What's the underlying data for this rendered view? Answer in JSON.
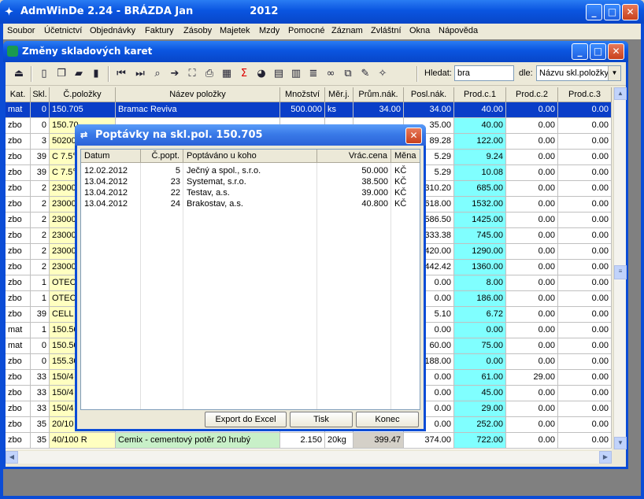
{
  "app": {
    "title": "AdmWinDe 2.24 - BRÁZDA Jan",
    "year": "2012",
    "logo": "app-logo-icon"
  },
  "menu": [
    "Soubor",
    "Účetnictví",
    "Objednávky",
    "Faktury",
    "Zásoby",
    "Majetek",
    "Mzdy",
    "Pomocné",
    "Záznam",
    "Zvláštní",
    "Okna",
    "Nápověda"
  ],
  "child": {
    "title": "Změny skladových karet",
    "search_label": "Hledat:",
    "search_value": "bra",
    "by_label": "dle:",
    "by_value": "Názvu skl.položky"
  },
  "grid": {
    "headers": [
      "Kat.",
      "Skl.",
      "Č.položky",
      "Název položky",
      "Množství",
      "Měr.j.",
      "Prům.nák.",
      "Posl.nák.",
      "Prod.c.1",
      "Prod.c.2",
      "Prod.c.3"
    ],
    "rows": [
      [
        "mat",
        "0",
        "150.705",
        "Bramac Reviva",
        "500.000",
        "ks",
        "34.00",
        "34.00",
        "40.00",
        "0.00",
        "0.00"
      ],
      [
        "zbo",
        "0",
        "150.70",
        "",
        "",
        "",
        "",
        "35.00",
        "40.00",
        "0.00",
        "0.00"
      ],
      [
        "zbo",
        "3",
        "50200",
        "",
        "",
        "",
        "",
        "89.28",
        "122.00",
        "0.00",
        "0.00"
      ],
      [
        "zbo",
        "39",
        "C 7.5°",
        "",
        "",
        "",
        "",
        "5.29",
        "9.24",
        "0.00",
        "0.00"
      ],
      [
        "zbo",
        "39",
        "C 7.5°",
        "",
        "",
        "",
        "",
        "5.29",
        "10.08",
        "0.00",
        "0.00"
      ],
      [
        "zbo",
        "2",
        "23000",
        "",
        "",
        "",
        "",
        "310.20",
        "685.00",
        "0.00",
        "0.00"
      ],
      [
        "zbo",
        "2",
        "23000",
        "",
        "",
        "",
        "",
        "618.00",
        "1532.00",
        "0.00",
        "0.00"
      ],
      [
        "zbo",
        "2",
        "23000",
        "",
        "",
        "",
        "",
        "586.50",
        "1425.00",
        "0.00",
        "0.00"
      ],
      [
        "zbo",
        "2",
        "23000",
        "",
        "",
        "",
        "",
        "333.38",
        "745.00",
        "0.00",
        "0.00"
      ],
      [
        "zbo",
        "2",
        "23000",
        "",
        "",
        "",
        "",
        "420.00",
        "1290.00",
        "0.00",
        "0.00"
      ],
      [
        "zbo",
        "2",
        "23000",
        "",
        "",
        "",
        "",
        "442.42",
        "1360.00",
        "0.00",
        "0.00"
      ],
      [
        "zbo",
        "1",
        "OTEC",
        "",
        "",
        "",
        "",
        "0.00",
        "8.00",
        "0.00",
        "0.00"
      ],
      [
        "zbo",
        "1",
        "OTEC",
        "",
        "",
        "",
        "",
        "0.00",
        "186.00",
        "0.00",
        "0.00"
      ],
      [
        "zbo",
        "39",
        "CELL",
        "",
        "",
        "",
        "",
        "5.10",
        "6.72",
        "0.00",
        "0.00"
      ],
      [
        "mat",
        "1",
        "150.50",
        "",
        "",
        "",
        "",
        "0.00",
        "0.00",
        "0.00",
        "0.00"
      ],
      [
        "mat",
        "0",
        "150.50",
        "",
        "",
        "",
        "",
        "60.00",
        "75.00",
        "0.00",
        "0.00"
      ],
      [
        "zbo",
        "0",
        "155.30",
        "",
        "",
        "",
        "",
        "188.00",
        "0.00",
        "0.00",
        "0.00"
      ],
      [
        "zbo",
        "33",
        "150/4",
        "",
        "",
        "",
        "",
        "0.00",
        "61.00",
        "29.00",
        "0.00"
      ],
      [
        "zbo",
        "33",
        "150/4",
        "",
        "",
        "",
        "",
        "0.00",
        "45.00",
        "0.00",
        "0.00"
      ],
      [
        "zbo",
        "33",
        "150/4",
        "",
        "",
        "",
        "",
        "0.00",
        "29.00",
        "0.00",
        "0.00"
      ],
      [
        "zbo",
        "35",
        "20/10",
        "",
        "",
        "",
        "",
        "0.00",
        "252.00",
        "0.00",
        "0.00"
      ],
      [
        "zbo",
        "35",
        "40/100 R",
        "Cemix - cementový potěr 20 hrubý",
        "2.150",
        "20kg",
        "399.47",
        "374.00",
        "722.00",
        "0.00",
        "0.00"
      ]
    ]
  },
  "dialog": {
    "title": "Poptávky na skl.pol. 150.705",
    "headers": [
      "Datum",
      "Č.popt.",
      "Poptáváno u koho",
      "Vrác.cena",
      "Měna"
    ],
    "rows": [
      [
        "12.02.2012",
        "5",
        "Ječný a spol., s.r.o.",
        "50.000",
        "KČ"
      ],
      [
        "13.04.2012",
        "23",
        "Systemat, s.r.o.",
        "38.500",
        "KČ"
      ],
      [
        "13.04.2012",
        "22",
        "Testav, a.s.",
        "39.000",
        "KČ"
      ],
      [
        "13.04.2012",
        "24",
        "Brakostav, a.s.",
        "40.800",
        "KČ"
      ]
    ],
    "buttons": {
      "export": "Export do Excel",
      "print": "Tisk",
      "close": "Konec"
    }
  },
  "window_controls": {
    "minimize": "_",
    "maximize": "□",
    "close": "✕"
  }
}
